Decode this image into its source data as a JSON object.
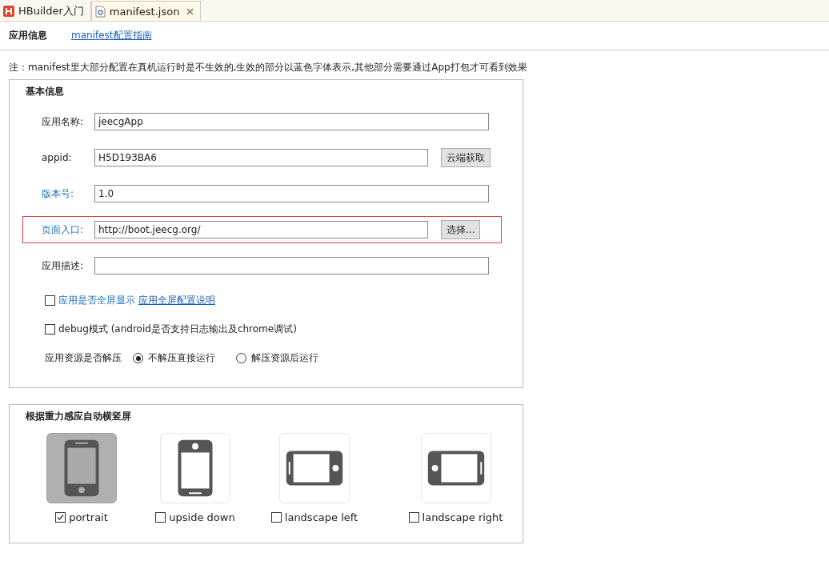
{
  "tabs": [
    {
      "label": "HBuilder入门",
      "kind": "hbuilder",
      "selected": false,
      "closable": false
    },
    {
      "label": "manifest.json",
      "kind": "file",
      "selected": true,
      "closable": true
    }
  ],
  "header": {
    "title": "应用信息",
    "link": "manifest配置指南"
  },
  "note": "注：manifest里大部分配置在真机运行时是不生效的,生效的部分以蓝色字体表示,其他部分需要通过App打包才可看到效果",
  "basic": {
    "title": "基本信息",
    "fields": [
      {
        "label": "应用名称:",
        "value": "jeecgApp",
        "effective": false,
        "highlighted": false
      },
      {
        "label": "appid:",
        "value": "H5D193BA6",
        "effective": false,
        "highlighted": false,
        "button": "云端获取"
      },
      {
        "label": "版本号:",
        "value": "1.0",
        "effective": true,
        "highlighted": false
      },
      {
        "label": "页面入口:",
        "value": "http://boot.jeecg.org/",
        "effective": true,
        "highlighted": true,
        "button": "选择..."
      },
      {
        "label": "应用描述:",
        "effective": false,
        "highlighted": false
      }
    ],
    "checkboxes": [
      {
        "label": "应用是否全屏显示",
        "link": "应用全屏配置说明",
        "effective": true,
        "checked": false
      },
      {
        "label": "debug模式 (android是否支持日志输出及chrome调试)",
        "effective": false,
        "checked": false
      }
    ],
    "radio_group": {
      "label": "应用资源是否解压",
      "options": [
        {
          "label": "不解压直接运行",
          "selected": true
        },
        {
          "label": "解压资源后运行",
          "selected": false
        }
      ]
    }
  },
  "orientation": {
    "title": "根据重力感应自动横竖屏",
    "options": [
      {
        "kind": "portrait",
        "label": "portrait",
        "checked": true
      },
      {
        "kind": "upside-down",
        "label": "upside down",
        "checked": false
      },
      {
        "kind": "landscape-left",
        "label": "landscape left",
        "checked": false
      },
      {
        "kind": "landscape-right",
        "label": "landscape right",
        "checked": false
      }
    ]
  }
}
